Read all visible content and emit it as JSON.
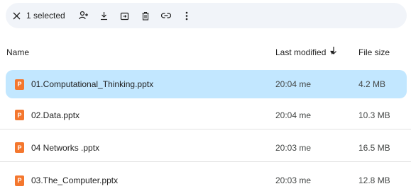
{
  "toolbar": {
    "selected_label": "1 selected",
    "actions": [
      "close",
      "share",
      "download",
      "move",
      "delete",
      "copy-link",
      "more"
    ]
  },
  "header": {
    "name": "Name",
    "last_modified": "Last modified",
    "file_size": "File size"
  },
  "files": [
    {
      "icon_letter": "P",
      "name": "01.Computational_Thinking.pptx",
      "modified": "20:04 me",
      "size": "4.2 MB",
      "selected": true
    },
    {
      "icon_letter": "P",
      "name": "02.Data.pptx",
      "modified": "20:04 me",
      "size": "10.3 MB",
      "selected": false
    },
    {
      "icon_letter": "P",
      "name": "04 Networks .pptx",
      "modified": "20:03 me",
      "size": "16.5 MB",
      "selected": false
    },
    {
      "icon_letter": "P",
      "name": "03.The_Computer.pptx",
      "modified": "20:03 me",
      "size": "12.8 MB",
      "selected": false
    }
  ],
  "colors": {
    "toolbar_bg": "#f1f4f9",
    "selected_row_bg": "#c2e7ff",
    "pptx_icon": "#f4772e"
  }
}
